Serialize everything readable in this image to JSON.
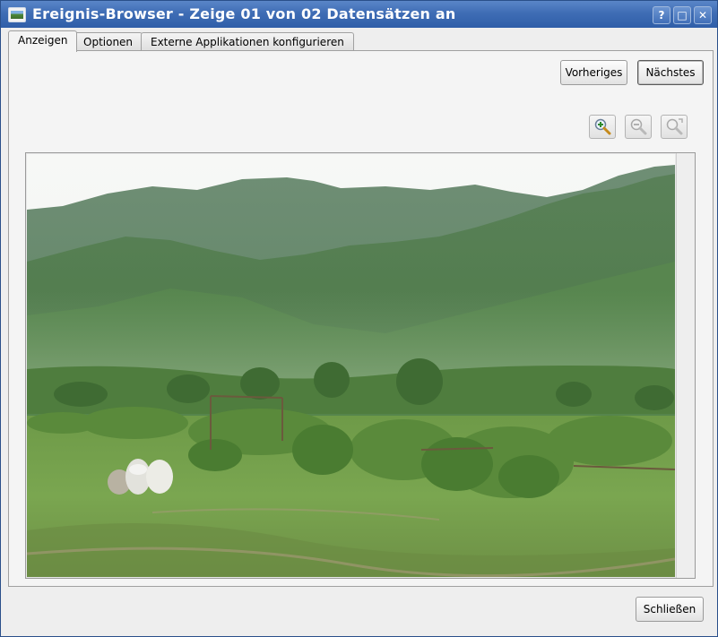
{
  "window": {
    "title": "Ereignis-Browser - Zeige 01 von 02 Datensätzen an",
    "buttons": {
      "help": "?",
      "maximize": "□",
      "close": "✕"
    }
  },
  "tabs": [
    {
      "label": "Anzeigen",
      "active": true
    },
    {
      "label": "Optionen",
      "active": false
    },
    {
      "label": "Externe Applikationen konfigurieren",
      "active": false
    }
  ],
  "nav": {
    "previous_label": "Vorheriges",
    "next_label": "Nächstes"
  },
  "zoom_tools": [
    "zoom-in-icon",
    "zoom-out-icon",
    "zoom-full-icon"
  ],
  "footer": {
    "close_label": "Schließen"
  },
  "colors": {
    "titlebar": "#3f6db5",
    "panel": "#f4f4f4"
  }
}
